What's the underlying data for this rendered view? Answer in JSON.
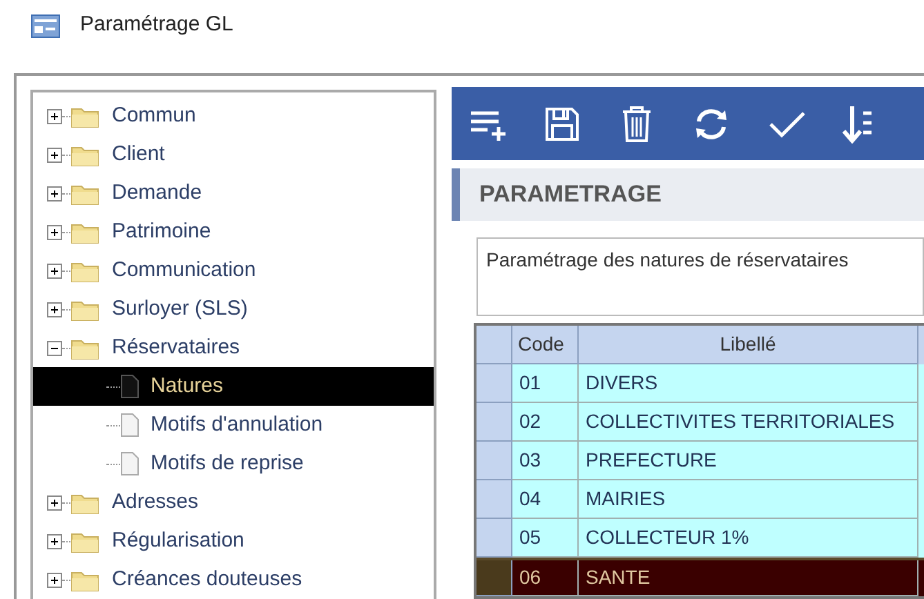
{
  "window": {
    "title": "Paramétrage GL"
  },
  "tree": [
    {
      "label": "Commun",
      "kind": "folder",
      "expanded": false,
      "selected": false
    },
    {
      "label": "Client",
      "kind": "folder",
      "expanded": false,
      "selected": false
    },
    {
      "label": "Demande",
      "kind": "folder",
      "expanded": false,
      "selected": false
    },
    {
      "label": "Patrimoine",
      "kind": "folder",
      "expanded": false,
      "selected": false
    },
    {
      "label": "Communication",
      "kind": "folder",
      "expanded": false,
      "selected": false
    },
    {
      "label": "Surloyer (SLS)",
      "kind": "folder",
      "expanded": false,
      "selected": false
    },
    {
      "label": "Réservataires",
      "kind": "folder",
      "expanded": true,
      "selected": false,
      "children": [
        {
          "label": "Natures",
          "kind": "page",
          "selected": true
        },
        {
          "label": "Motifs d'annulation",
          "kind": "page",
          "selected": false
        },
        {
          "label": "Motifs de reprise",
          "kind": "page",
          "selected": false
        }
      ]
    },
    {
      "label": "Adresses",
      "kind": "folder",
      "expanded": false,
      "selected": false
    },
    {
      "label": "Régularisation",
      "kind": "folder",
      "expanded": false,
      "selected": false
    },
    {
      "label": "Créances douteuses",
      "kind": "folder",
      "expanded": false,
      "selected": false
    }
  ],
  "toolbar": [
    {
      "kind": "add"
    },
    {
      "kind": "save"
    },
    {
      "kind": "delete"
    },
    {
      "kind": "refresh"
    },
    {
      "kind": "validate"
    },
    {
      "kind": "sort"
    }
  ],
  "section": {
    "title": "PARAMETRAGE"
  },
  "description": "Paramétrage des natures de réservataires",
  "table": {
    "columns": [
      "Code",
      "Libellé"
    ],
    "rows": [
      {
        "cells": [
          "01",
          "DIVERS"
        ],
        "selected": false
      },
      {
        "cells": [
          "02",
          "COLLECTIVITES TERRITORIALES"
        ],
        "selected": false
      },
      {
        "cells": [
          "03",
          "PREFECTURE"
        ],
        "selected": false
      },
      {
        "cells": [
          "04",
          "MAIRIES"
        ],
        "selected": false
      },
      {
        "cells": [
          "05",
          "COLLECTEUR 1%"
        ],
        "selected": false
      },
      {
        "cells": [
          "06",
          "SANTE"
        ],
        "selected": true
      }
    ]
  }
}
